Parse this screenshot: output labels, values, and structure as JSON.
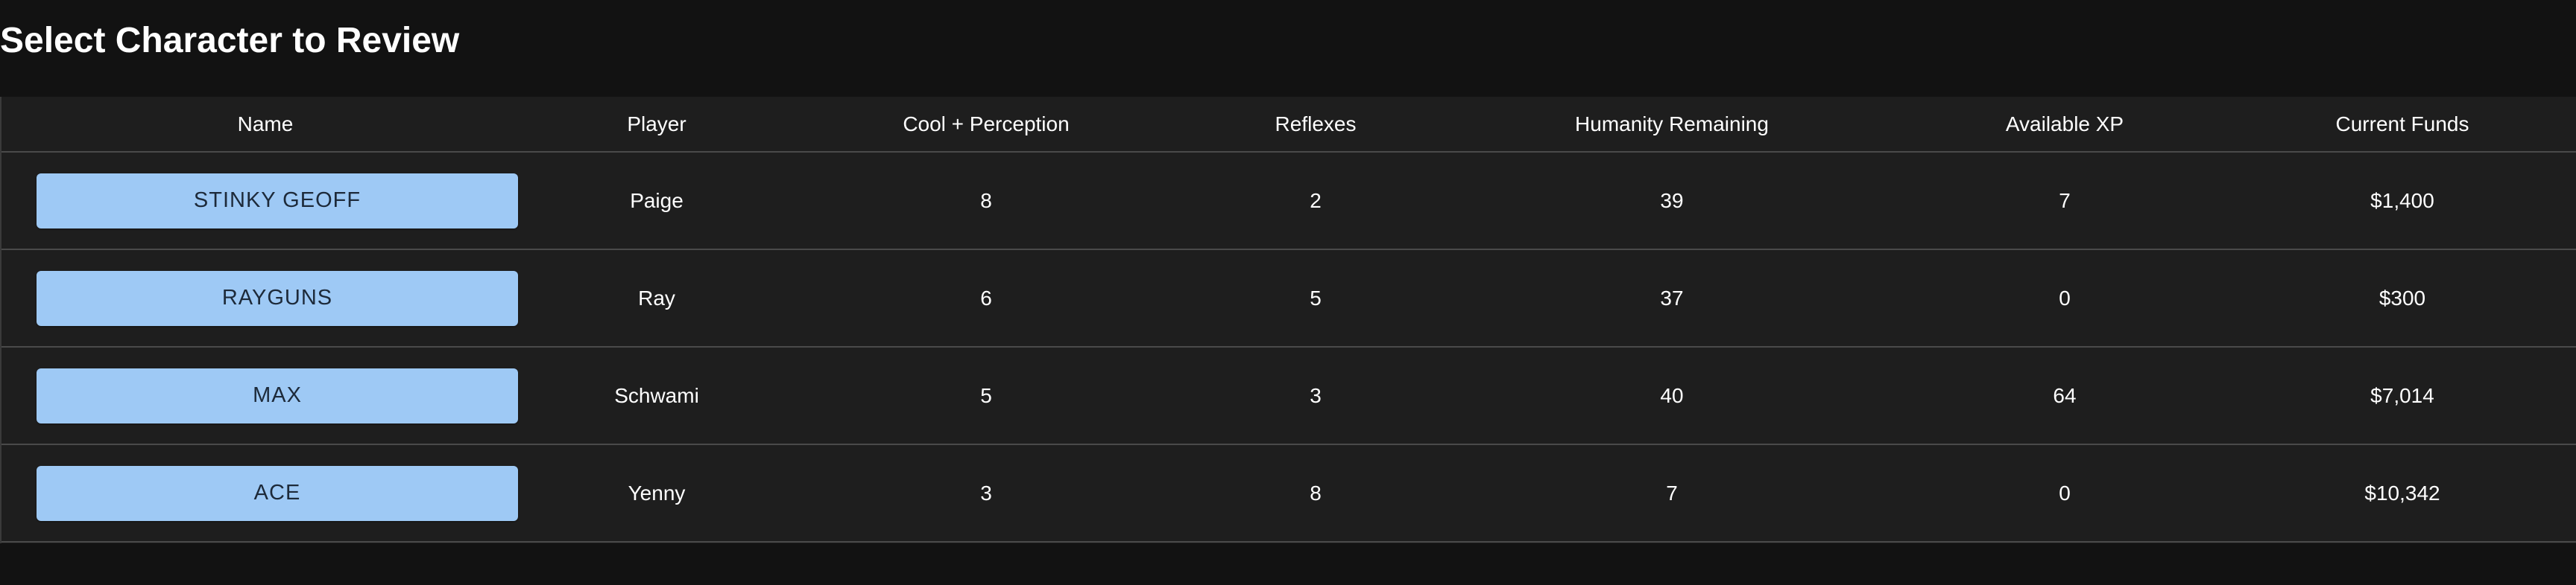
{
  "page": {
    "title": "Select Character to Review"
  },
  "colors": {
    "background": "#121212",
    "table_background": "#1e1e1e",
    "button_background": "#9ec9f5",
    "button_text": "#1d2a3a",
    "divider": "#4a4a4a"
  },
  "table": {
    "headers": {
      "name": "Name",
      "player": "Player",
      "cool_perception": "Cool + Perception",
      "reflexes": "Reflexes",
      "humanity": "Humanity Remaining",
      "xp": "Available XP",
      "funds": "Current Funds"
    },
    "rows": [
      {
        "name": "STINKY GEOFF",
        "player": "Paige",
        "cool_perception": "8",
        "reflexes": "2",
        "humanity": "39",
        "xp": "7",
        "funds": "$1,400"
      },
      {
        "name": "RAYGUNS",
        "player": "Ray",
        "cool_perception": "6",
        "reflexes": "5",
        "humanity": "37",
        "xp": "0",
        "funds": "$300"
      },
      {
        "name": "MAX",
        "player": "Schwami",
        "cool_perception": "5",
        "reflexes": "3",
        "humanity": "40",
        "xp": "64",
        "funds": "$7,014"
      },
      {
        "name": "ACE",
        "player": "Yenny",
        "cool_perception": "3",
        "reflexes": "8",
        "humanity": "7",
        "xp": "0",
        "funds": "$10,342"
      }
    ]
  }
}
